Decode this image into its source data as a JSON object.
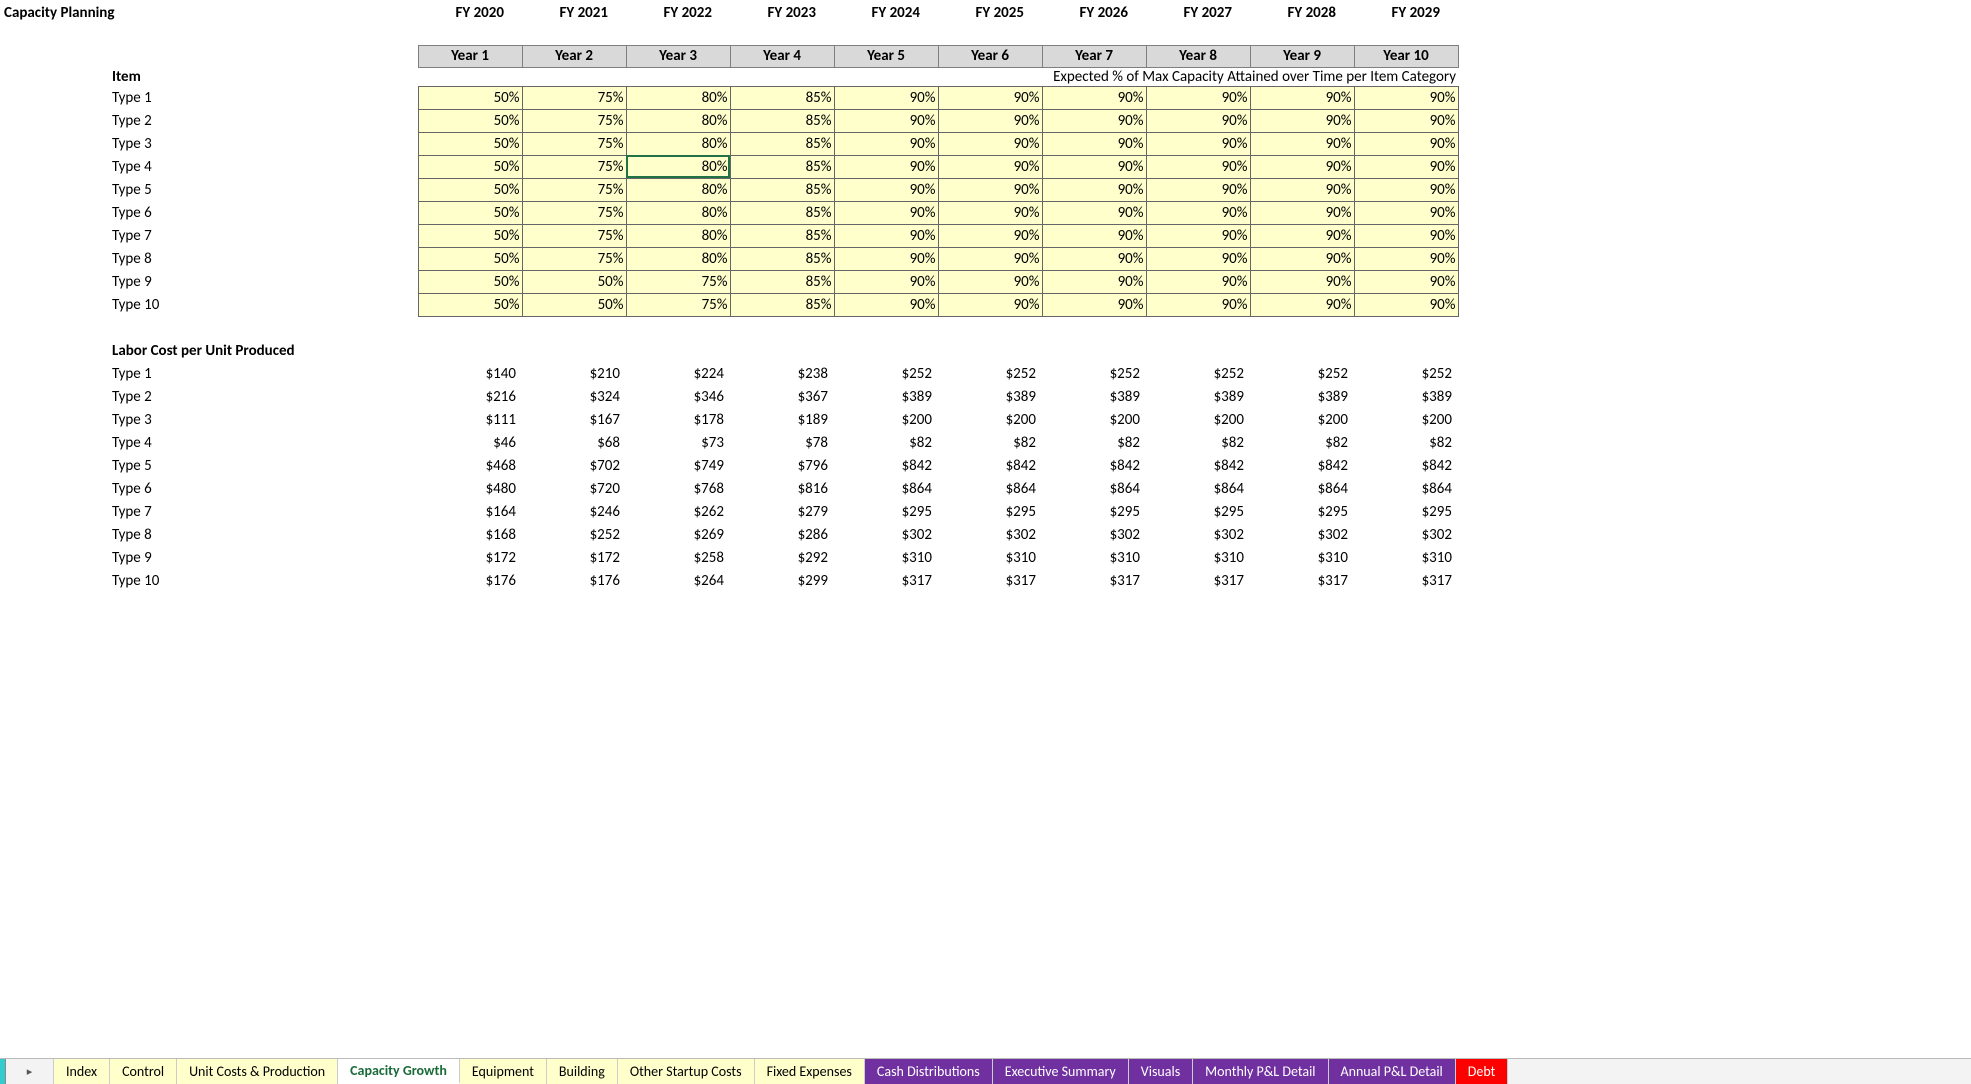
{
  "title": "Capacity Planning",
  "fy_headers": [
    "FY 2020",
    "FY 2021",
    "FY 2022",
    "FY 2023",
    "FY 2024",
    "FY 2025",
    "FY 2026",
    "FY 2027",
    "FY 2028",
    "FY 2029"
  ],
  "year_headers": [
    "Year 1",
    "Year 2",
    "Year 3",
    "Year 4",
    "Year 5",
    "Year 6",
    "Year 7",
    "Year 8",
    "Year 9",
    "Year 10"
  ],
  "item_label": "Item",
  "expected_note": "Expected % of Max Capacity Attained over Time per Item Category",
  "capacity_rows": [
    {
      "label": "Type 1",
      "vals": [
        "50%",
        "75%",
        "80%",
        "85%",
        "90%",
        "90%",
        "90%",
        "90%",
        "90%",
        "90%"
      ]
    },
    {
      "label": "Type 2",
      "vals": [
        "50%",
        "75%",
        "80%",
        "85%",
        "90%",
        "90%",
        "90%",
        "90%",
        "90%",
        "90%"
      ]
    },
    {
      "label": "Type 3",
      "vals": [
        "50%",
        "75%",
        "80%",
        "85%",
        "90%",
        "90%",
        "90%",
        "90%",
        "90%",
        "90%"
      ]
    },
    {
      "label": "Type 4",
      "vals": [
        "50%",
        "75%",
        "80%",
        "85%",
        "90%",
        "90%",
        "90%",
        "90%",
        "90%",
        "90%"
      ]
    },
    {
      "label": "Type 5",
      "vals": [
        "50%",
        "75%",
        "80%",
        "85%",
        "90%",
        "90%",
        "90%",
        "90%",
        "90%",
        "90%"
      ]
    },
    {
      "label": "Type 6",
      "vals": [
        "50%",
        "75%",
        "80%",
        "85%",
        "90%",
        "90%",
        "90%",
        "90%",
        "90%",
        "90%"
      ]
    },
    {
      "label": "Type 7",
      "vals": [
        "50%",
        "75%",
        "80%",
        "85%",
        "90%",
        "90%",
        "90%",
        "90%",
        "90%",
        "90%"
      ]
    },
    {
      "label": "Type 8",
      "vals": [
        "50%",
        "75%",
        "80%",
        "85%",
        "90%",
        "90%",
        "90%",
        "90%",
        "90%",
        "90%"
      ]
    },
    {
      "label": "Type 9",
      "vals": [
        "50%",
        "50%",
        "75%",
        "85%",
        "90%",
        "90%",
        "90%",
        "90%",
        "90%",
        "90%"
      ]
    },
    {
      "label": "Type 10",
      "vals": [
        "50%",
        "50%",
        "75%",
        "85%",
        "90%",
        "90%",
        "90%",
        "90%",
        "90%",
        "90%"
      ]
    }
  ],
  "labor_header": "Labor Cost per Unit Produced",
  "labor_rows": [
    {
      "label": "Type 1",
      "vals": [
        "$140",
        "$210",
        "$224",
        "$238",
        "$252",
        "$252",
        "$252",
        "$252",
        "$252",
        "$252"
      ]
    },
    {
      "label": "Type 2",
      "vals": [
        "$216",
        "$324",
        "$346",
        "$367",
        "$389",
        "$389",
        "$389",
        "$389",
        "$389",
        "$389"
      ]
    },
    {
      "label": "Type 3",
      "vals": [
        "$111",
        "$167",
        "$178",
        "$189",
        "$200",
        "$200",
        "$200",
        "$200",
        "$200",
        "$200"
      ]
    },
    {
      "label": "Type 4",
      "vals": [
        "$46",
        "$68",
        "$73",
        "$78",
        "$82",
        "$82",
        "$82",
        "$82",
        "$82",
        "$82"
      ]
    },
    {
      "label": "Type 5",
      "vals": [
        "$468",
        "$702",
        "$749",
        "$796",
        "$842",
        "$842",
        "$842",
        "$842",
        "$842",
        "$842"
      ]
    },
    {
      "label": "Type 6",
      "vals": [
        "$480",
        "$720",
        "$768",
        "$816",
        "$864",
        "$864",
        "$864",
        "$864",
        "$864",
        "$864"
      ]
    },
    {
      "label": "Type 7",
      "vals": [
        "$164",
        "$246",
        "$262",
        "$279",
        "$295",
        "$295",
        "$295",
        "$295",
        "$295",
        "$295"
      ]
    },
    {
      "label": "Type 8",
      "vals": [
        "$168",
        "$252",
        "$269",
        "$286",
        "$302",
        "$302",
        "$302",
        "$302",
        "$302",
        "$302"
      ]
    },
    {
      "label": "Type 9",
      "vals": [
        "$172",
        "$172",
        "$258",
        "$292",
        "$310",
        "$310",
        "$310",
        "$310",
        "$310",
        "$310"
      ]
    },
    {
      "label": "Type 10",
      "vals": [
        "$176",
        "$176",
        "$264",
        "$299",
        "$317",
        "$317",
        "$317",
        "$317",
        "$317",
        "$317"
      ]
    }
  ],
  "selected_cell": {
    "row": 3,
    "col": 2
  },
  "tabs": [
    {
      "label": "Index",
      "style": "yellow"
    },
    {
      "label": "Control",
      "style": "yellow"
    },
    {
      "label": "Unit Costs & Production",
      "style": "yellow"
    },
    {
      "label": "Capacity Growth",
      "style": "active"
    },
    {
      "label": "Equipment",
      "style": "yellow"
    },
    {
      "label": "Building",
      "style": "yellow"
    },
    {
      "label": "Other Startup Costs",
      "style": "yellow"
    },
    {
      "label": "Fixed Expenses",
      "style": "yellow"
    },
    {
      "label": "Cash Distributions",
      "style": "purple"
    },
    {
      "label": "Executive Summary",
      "style": "purple"
    },
    {
      "label": "Visuals",
      "style": "purple"
    },
    {
      "label": "Monthly P&L Detail",
      "style": "purple"
    },
    {
      "label": "Annual P&L Detail",
      "style": "purple"
    },
    {
      "label": "Debt",
      "style": "red"
    }
  ],
  "nav_glyph": "▸"
}
